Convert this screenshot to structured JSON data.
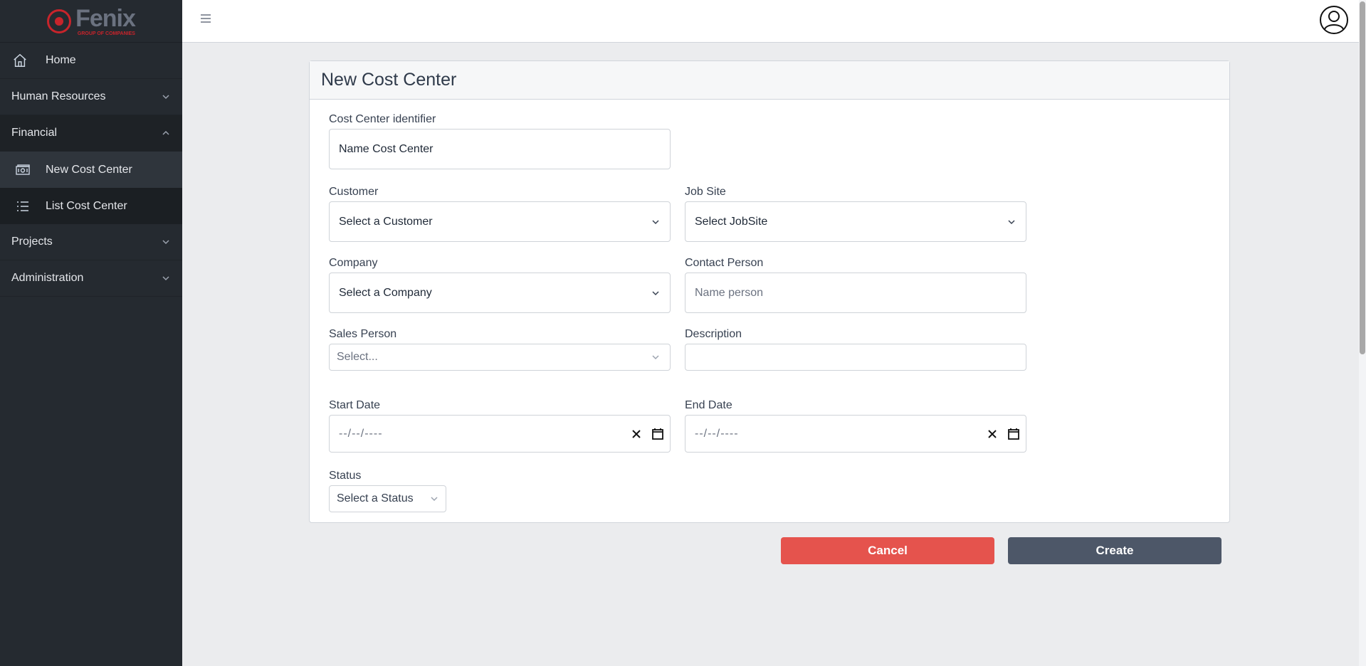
{
  "brand": {
    "name": "Fenix",
    "subtitle": "GROUP OF COMPANIES",
    "accent": "#c8242b"
  },
  "sidebar": {
    "items": [
      {
        "label": "Home",
        "icon": "home-icon"
      },
      {
        "label": "Human Resources",
        "icon": "chevron-down-icon"
      },
      {
        "label": "Financial",
        "icon": "chevron-up-icon"
      },
      {
        "label": "New Cost Center",
        "icon": "cash-icon",
        "active": true
      },
      {
        "label": "List Cost Center",
        "icon": "list-icon"
      },
      {
        "label": "Projects",
        "icon": "chevron-down-icon"
      },
      {
        "label": "Administration",
        "icon": "chevron-down-icon"
      }
    ]
  },
  "topbar": {
    "menu_icon": "hamburger-icon",
    "user_icon": "user-avatar-icon"
  },
  "form": {
    "title": "New Cost Center",
    "cost_center": {
      "label": "Cost Center identifier",
      "value": "Name Cost Center"
    },
    "customer": {
      "label": "Customer",
      "value": "Select a Customer"
    },
    "job_site": {
      "label": "Job Site",
      "value": "Select JobSite"
    },
    "company": {
      "label": "Company",
      "value": "Select a Company"
    },
    "contact_person": {
      "label": "Contact Person",
      "placeholder": "Name person"
    },
    "sales_person": {
      "label": "Sales Person",
      "placeholder": "Select..."
    },
    "description": {
      "label": "Description",
      "value": ""
    },
    "start_date": {
      "label": "Start Date",
      "value": "--/--/----"
    },
    "end_date": {
      "label": "End Date",
      "value": "--/--/----"
    },
    "status": {
      "label": "Status",
      "value": "Select a Status"
    }
  },
  "actions": {
    "cancel": "Cancel",
    "create": "Create"
  },
  "colors": {
    "cancel": "#e5534d",
    "create": "#4d5768",
    "sidebar": "#252a30"
  }
}
